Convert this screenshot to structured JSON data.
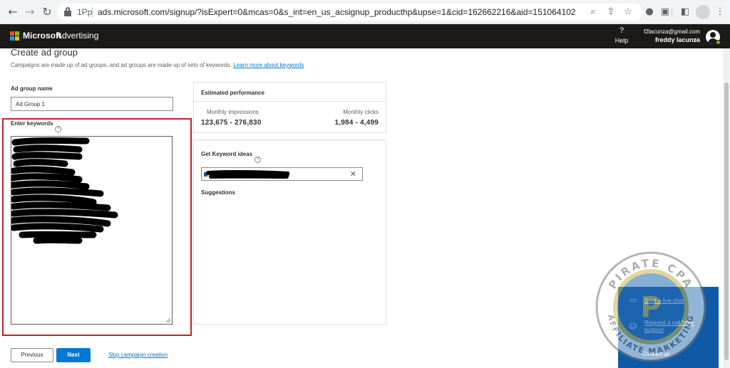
{
  "browser": {
    "site_badge": "1Pp",
    "url": "ads.microsoft.com/signup/?isExpert=0&mcas=0&s_int=en_us_acsignup_producthp&upse=1&cid=162662216&aid=151064102"
  },
  "header": {
    "brand": "Microsoft",
    "product": "Advertising",
    "help_label": "Help",
    "help_icon": "?",
    "user_email": "f2lacunza@gmail.com",
    "user_name": "freddy lacunza",
    "status_color": "#6bb700"
  },
  "page": {
    "title": "Create ad group",
    "description": "Campaigns are made up of ad groups, and ad groups are made up of sets of keywords. ",
    "learn_more": "Learn more about keywords"
  },
  "form": {
    "ad_group_name_label": "Ad group name",
    "ad_group_name_value": "Ad Group 1",
    "keywords_label": "Enter keywords",
    "info_icon": "?"
  },
  "estimated_performance": {
    "title": "Estimated performance",
    "impressions_label": "Monthly impressions",
    "impressions_value": "123,675 - 276,830",
    "clicks_label": "Monthly clicks",
    "clicks_value": "1,984 - 4,499"
  },
  "keyword_ideas": {
    "title": "Get Keyword ideas",
    "clear_icon": "✕",
    "suggestions_label": "Suggestions"
  },
  "actions": {
    "previous": "Previous",
    "next": "Next",
    "skip": "Skip campaign creation"
  },
  "contact": {
    "live_chat": "Start a live chat",
    "request_call": "Request a call from support",
    "contact_us": "Contact us"
  },
  "watermark": {
    "top_text": "PIRATE CPA",
    "bottom_text": "AFFILIATE MARKETING",
    "letter": "P"
  },
  "colors": {
    "accent": "#0078d4",
    "highlight": "#c8202a",
    "header_bg": "#1b1a19",
    "contact_bg": "#0e5aa7"
  }
}
